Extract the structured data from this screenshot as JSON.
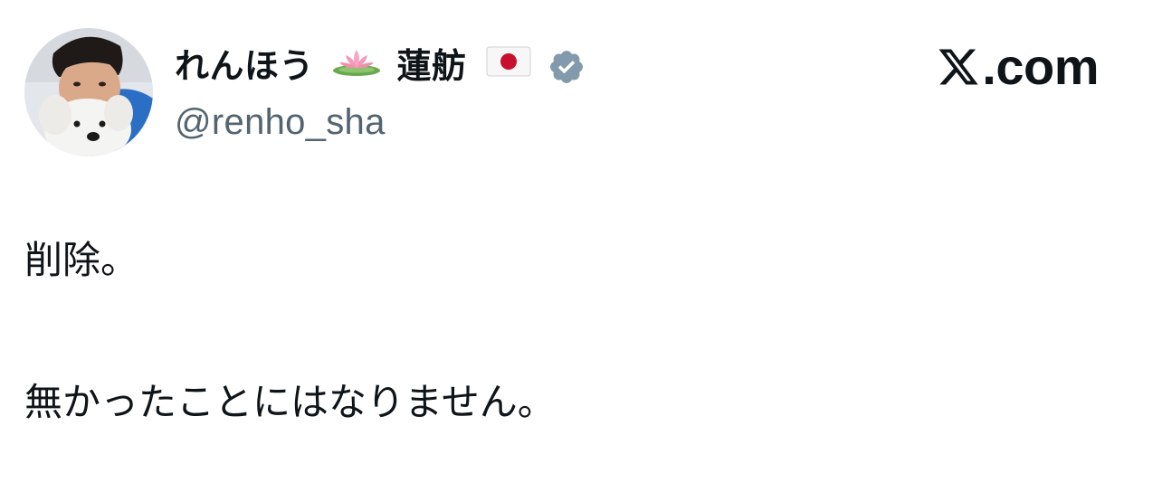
{
  "author": {
    "display_name_prefix": "れんほう",
    "display_name_suffix": "蓮舫",
    "handle": "@renho_sha",
    "avatar_icon": "profile-photo-with-white-dog",
    "name_icons": [
      "lotus-icon",
      "japan-flag-icon"
    ],
    "verified_icon": "verified-badge-icon",
    "verified_color": "#829aab"
  },
  "brand": {
    "site_label": ".com",
    "logo_icon": "x-logo-icon"
  },
  "tweet": {
    "lines": [
      "削除。",
      "無かったことにはなりません。"
    ]
  },
  "colors": {
    "text": "#0f1419",
    "secondary_text": "#536471",
    "background": "#ffffff"
  }
}
